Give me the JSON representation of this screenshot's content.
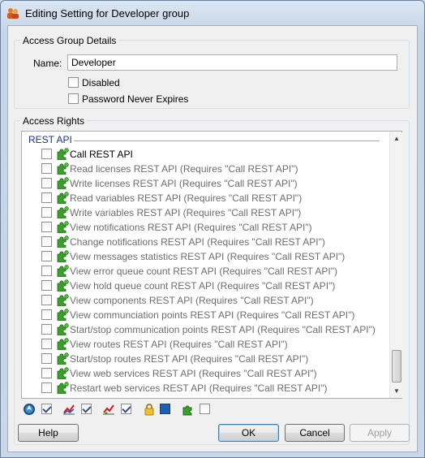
{
  "window": {
    "title": "Editing Setting for Developer group"
  },
  "access_group": {
    "caption": "Access Group Details",
    "name_label": "Name:",
    "name_value": "Developer",
    "disabled_label": "Disabled",
    "disabled_checked": false,
    "password_label": "Password Never Expires",
    "password_checked": false
  },
  "access_rights": {
    "caption": "Access Rights",
    "section": "REST API",
    "items": [
      {
        "label": "Call REST API",
        "checked": false,
        "enabled": true
      },
      {
        "label": "Read licenses REST API (Requires \"Call REST API\")",
        "checked": false,
        "enabled": false
      },
      {
        "label": "Write licenses REST API (Requires \"Call REST API\")",
        "checked": false,
        "enabled": false
      },
      {
        "label": "Read variables REST API (Requires \"Call REST API\")",
        "checked": false,
        "enabled": false
      },
      {
        "label": "Write variables REST API (Requires \"Call REST API\")",
        "checked": false,
        "enabled": false
      },
      {
        "label": "View notifications REST API (Requires \"Call REST API\")",
        "checked": false,
        "enabled": false
      },
      {
        "label": "Change notifications REST API (Requires \"Call REST API\")",
        "checked": false,
        "enabled": false
      },
      {
        "label": "View messages statistics REST API (Requires \"Call REST API\")",
        "checked": false,
        "enabled": false
      },
      {
        "label": "View error queue count REST API (Requires \"Call REST API\")",
        "checked": false,
        "enabled": false
      },
      {
        "label": "View hold queue count REST API (Requires \"Call REST API\")",
        "checked": false,
        "enabled": false
      },
      {
        "label": "View components REST API (Requires \"Call REST API\")",
        "checked": false,
        "enabled": false
      },
      {
        "label": "View communciation points REST API (Requires \"Call REST API\")",
        "checked": false,
        "enabled": false
      },
      {
        "label": "Start/stop communication points REST API (Requires \"Call REST API\")",
        "checked": false,
        "enabled": false
      },
      {
        "label": "View routes REST API (Requires \"Call REST API\")",
        "checked": false,
        "enabled": false
      },
      {
        "label": "Start/stop routes REST API (Requires \"Call REST API\")",
        "checked": false,
        "enabled": false
      },
      {
        "label": "View web services REST API (Requires \"Call REST API\")",
        "checked": false,
        "enabled": false
      },
      {
        "label": "Restart web services REST API (Requires \"Call REST API\")",
        "checked": false,
        "enabled": false
      }
    ]
  },
  "filters": [
    {
      "icon": "navigate-icon",
      "checked": true
    },
    {
      "icon": "chart-icon",
      "checked": true
    },
    {
      "icon": "chart-edit-icon",
      "checked": true
    },
    {
      "icon": "lock-icon",
      "checked": true
    },
    {
      "icon": "puzzle-icon",
      "checked": false
    }
  ],
  "buttons": {
    "help": "Help",
    "ok": "OK",
    "cancel": "Cancel",
    "apply": "Apply"
  },
  "colors": {
    "section_header": "#1e3287",
    "puzzle_green": "#3aa02a"
  }
}
